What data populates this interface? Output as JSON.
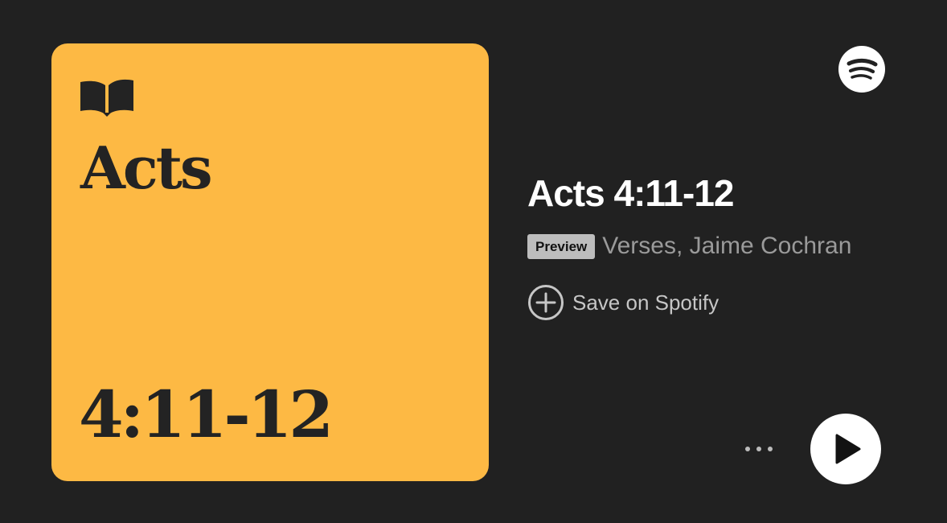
{
  "cover": {
    "title": "Acts",
    "reference": "4:11-12",
    "background_color": "#fdb944",
    "text_color": "#232323",
    "icon": "open-book-icon"
  },
  "episode": {
    "title": "Acts 4:11-12",
    "badge": "Preview",
    "artists": "Verses, Jaime Cochran"
  },
  "actions": {
    "save_label": "Save on Spotify",
    "save_icon": "plus-circle-icon",
    "more_icon": "more-dots-icon",
    "play_icon": "play-icon"
  },
  "brand": {
    "logo_icon": "spotify-logo-icon"
  },
  "colors": {
    "background": "#212121",
    "title": "#ffffff",
    "subtitle": "#9a9a9a",
    "badge_bg": "#bdbdbd"
  }
}
